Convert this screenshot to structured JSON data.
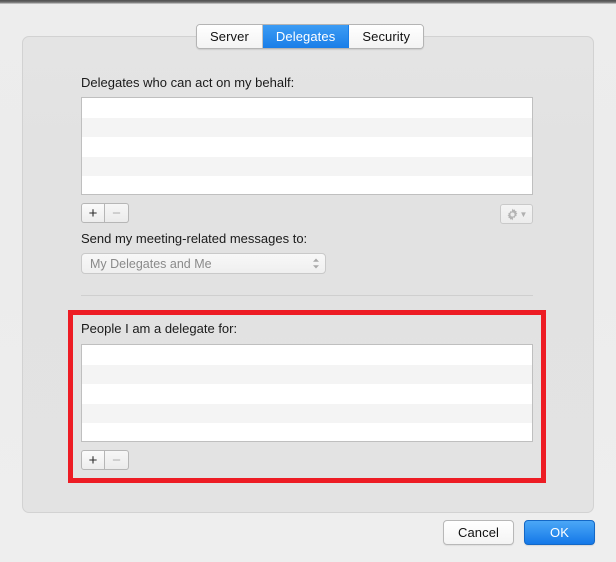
{
  "window": {
    "tabs": [
      {
        "label": "Server",
        "active": false
      },
      {
        "label": "Delegates",
        "active": true
      },
      {
        "label": "Security",
        "active": false
      }
    ],
    "accent_color": "#1a7ee8",
    "annotation_color": "#ed1c24"
  },
  "delegates_section": {
    "label": "Delegates who can act on my behalf:",
    "list_items": [],
    "list_row_count": 5,
    "add_button_label": "+",
    "remove_button_label": "−",
    "add_enabled": true,
    "remove_enabled": false,
    "action_icon": "gear-icon",
    "action_enabled": false
  },
  "send_to_section": {
    "label": "Send my meeting-related messages to:",
    "selected_value": "My Delegates and Me",
    "enabled": false,
    "options": [
      "My Delegates and Me"
    ]
  },
  "people_section": {
    "label": "People I am a delegate for:",
    "list_items": [],
    "list_row_count": 5,
    "add_button_label": "+",
    "remove_button_label": "−",
    "add_enabled": true,
    "remove_enabled": false
  },
  "footer": {
    "cancel_label": "Cancel",
    "ok_label": "OK"
  }
}
